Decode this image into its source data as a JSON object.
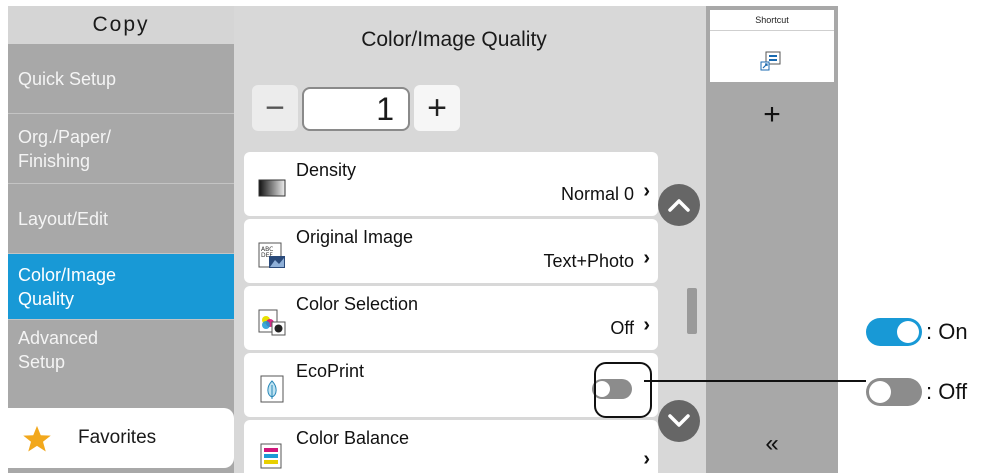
{
  "nav": {
    "title": "Copy",
    "items": [
      {
        "label": "Quick Setup"
      },
      {
        "label": "Org./Paper/\nFinishing"
      },
      {
        "label": "Layout/Edit"
      },
      {
        "label": "Color/Image\nQuality"
      },
      {
        "label": "Advanced\nSetup"
      }
    ],
    "active_index": 3,
    "favorites_label": "Favorites"
  },
  "main": {
    "title": "Color/Image Quality",
    "copies": {
      "minus": "−",
      "value": "1",
      "plus": "+"
    },
    "rows": [
      {
        "label": "Density",
        "value": "Normal 0",
        "icon": "density-icon"
      },
      {
        "label": "Original Image",
        "value": "Text+Photo",
        "icon": "original-image-icon"
      },
      {
        "label": "Color Selection",
        "value": "Off",
        "icon": "color-selection-icon"
      },
      {
        "label": "EcoPrint",
        "toggle": "off",
        "icon": "ecoprint-icon"
      },
      {
        "label": "Color Balance",
        "icon": "color-balance-icon"
      }
    ],
    "chevron": "›"
  },
  "right_panel": {
    "shortcut_label": "Shortcut",
    "add_label": "+",
    "collapse_label": "«"
  },
  "legend": {
    "on_label": ": On",
    "off_label": ": Off"
  },
  "colors": {
    "accent": "#1899d6",
    "toggle_off": "#8c8c8c",
    "nav_bg": "#a8a8a8"
  }
}
